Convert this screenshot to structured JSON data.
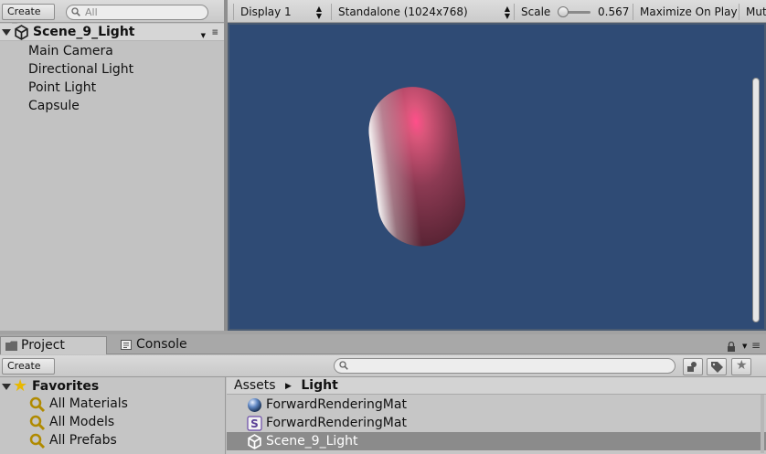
{
  "hierarchy": {
    "create_label": "Create",
    "search_placeholder": "All",
    "scene_name": "Scene_9_Light",
    "items": [
      "Main Camera",
      "Directional Light",
      "Point Light",
      "Capsule"
    ]
  },
  "game_view": {
    "display": "Display 1",
    "resolution": "Standalone (1024x768)",
    "scale_label": "Scale",
    "scale_value": "0.567",
    "scale_level": 0.1,
    "maximize_label": "Maximize On Play",
    "mute_label": "Mut",
    "viewport_color": "#2f4b75",
    "capsule_color": "#8a3a52"
  },
  "project": {
    "tabs": [
      {
        "label": "Project",
        "icon": "folder-icon"
      },
      {
        "label": "Console",
        "icon": "console-icon"
      }
    ],
    "create_label": "Create",
    "favorites_label": "Favorites",
    "favorites": [
      "All Materials",
      "All Models",
      "All Prefabs"
    ],
    "breadcrumb": [
      "Assets",
      "Light"
    ],
    "assets": [
      {
        "name": "ForwardRenderingMat",
        "icon": "material-sphere-icon"
      },
      {
        "name": "ForwardRenderingMat",
        "icon": "shader-icon"
      },
      {
        "name": "Scene_9_Light",
        "icon": "unity-scene-icon",
        "selected": true
      }
    ]
  }
}
